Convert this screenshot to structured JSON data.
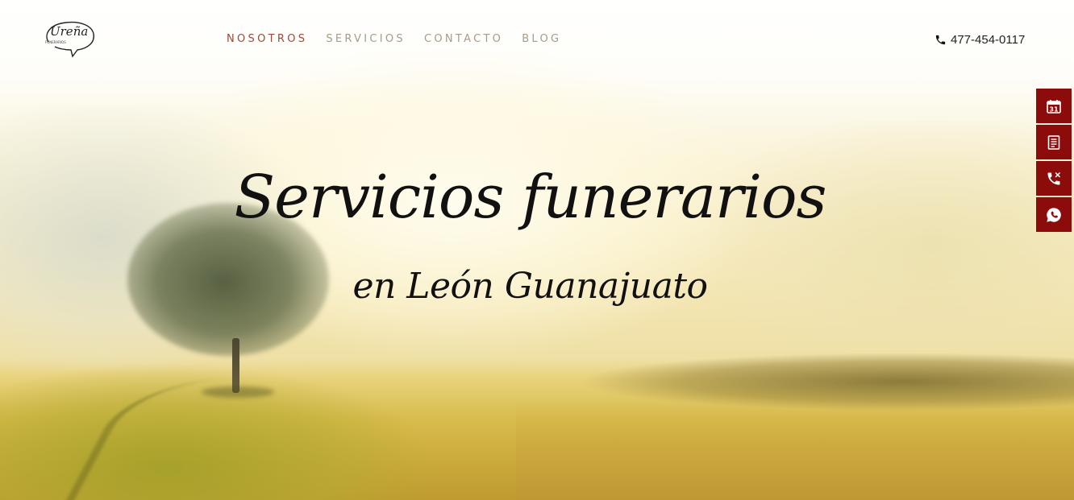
{
  "header": {
    "logo": {
      "brand_text": "Ureña",
      "sub_text": "FUNERARIOS"
    },
    "nav": [
      {
        "label": "NOSOTROS",
        "active": true
      },
      {
        "label": "SERVICIOS",
        "active": false
      },
      {
        "label": "CONTACTO",
        "active": false
      },
      {
        "label": "BLOG",
        "active": false
      }
    ],
    "phone": {
      "icon": "phone-icon",
      "number": "477-454-0117"
    }
  },
  "hero": {
    "title_line1": "Servicios funerarios",
    "title_line2": "en León Guanajuato"
  },
  "side_actions": [
    {
      "icon": "calendar-icon",
      "calendar_day": "31"
    },
    {
      "icon": "document-icon"
    },
    {
      "icon": "phone-call-icon"
    },
    {
      "icon": "whatsapp-icon"
    }
  ],
  "colors": {
    "accent": "#8c0b0b",
    "nav_active": "#9a4a38",
    "nav_text": "#a89a89",
    "text_dark": "#111111"
  }
}
